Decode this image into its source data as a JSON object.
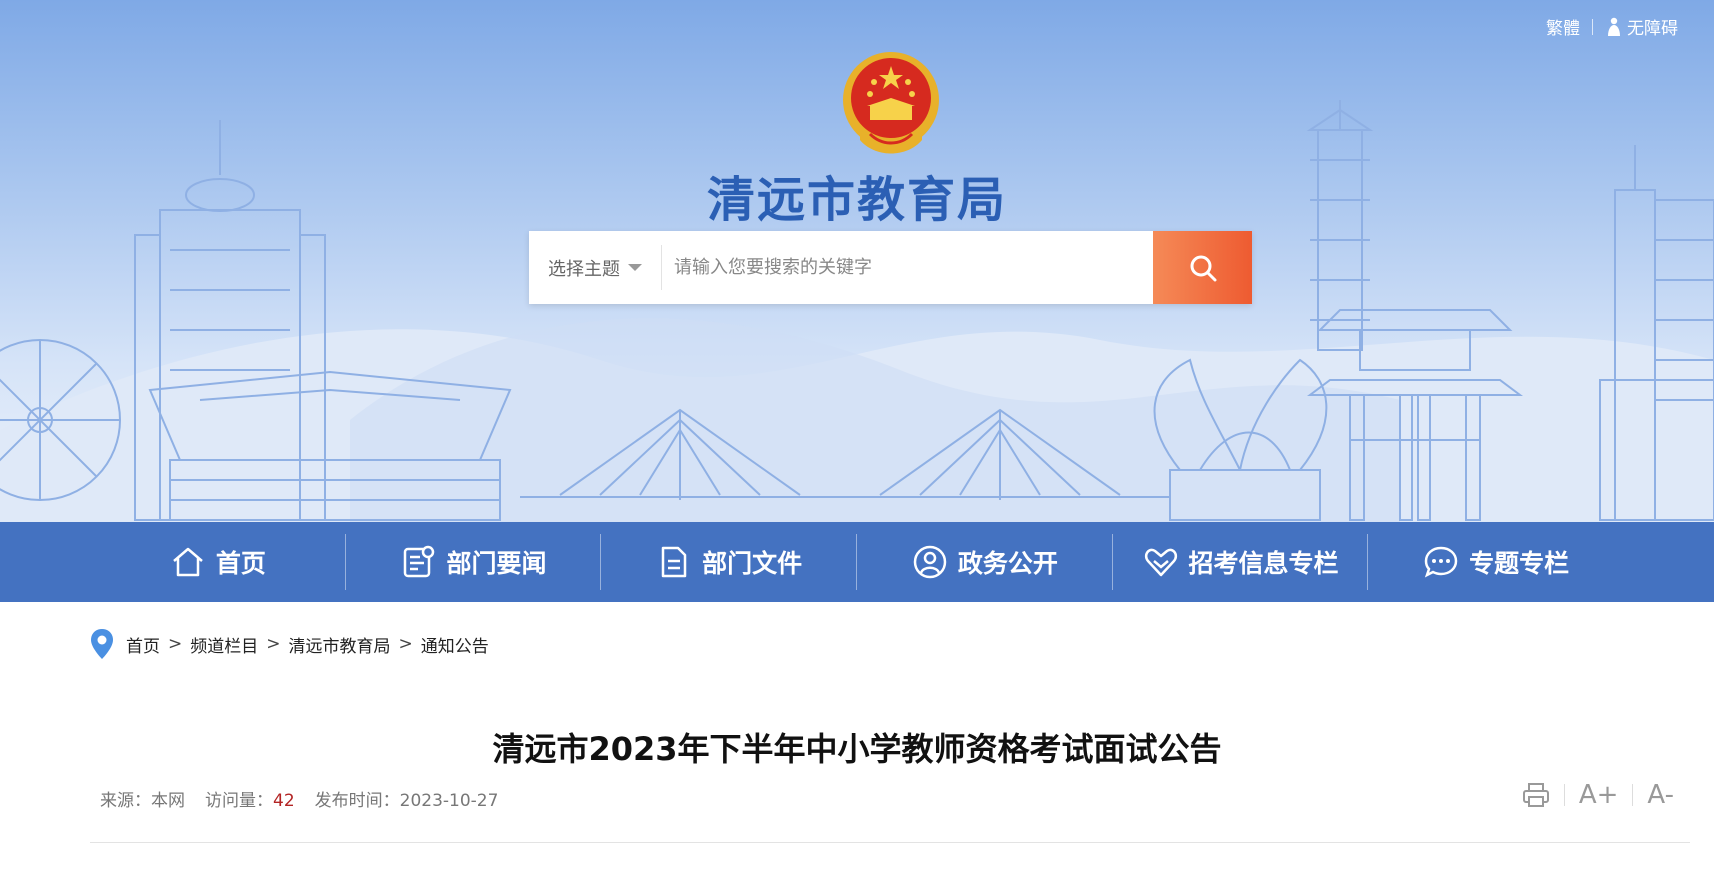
{
  "header": {
    "traditional_label": "繁體",
    "accessibility_label": "无障碍",
    "site_title": "清远市教育局"
  },
  "search": {
    "topic_label": "选择主题",
    "placeholder": "请输入您要搜索的关键字"
  },
  "nav": {
    "items": [
      {
        "label": "首页",
        "icon": "home-icon"
      },
      {
        "label": "部门要闻",
        "icon": "news-icon"
      },
      {
        "label": "部门文件",
        "icon": "document-icon"
      },
      {
        "label": "政务公开",
        "icon": "user-circle-icon"
      },
      {
        "label": "招考信息专栏",
        "icon": "heart-icon"
      },
      {
        "label": "专题专栏",
        "icon": "chat-icon"
      }
    ]
  },
  "breadcrumb": {
    "items": [
      "首页",
      "频道栏目",
      "清远市教育局",
      "通知公告"
    ],
    "separator": ">"
  },
  "article": {
    "title": "清远市2023年下半年中小学教师资格考试面试公告",
    "source_label": "来源：",
    "source_value": "本网",
    "views_label": "访问量：",
    "views_value": "42",
    "date_label": "发布时间：",
    "date_value": "2023-10-27"
  },
  "tools": {
    "font_increase": "A+",
    "font_decrease": "A-"
  },
  "colors": {
    "nav_bg": "#4472c1",
    "title_blue": "#2b5fb4",
    "search_button": "#ee5b31",
    "views_red": "#b32424"
  }
}
